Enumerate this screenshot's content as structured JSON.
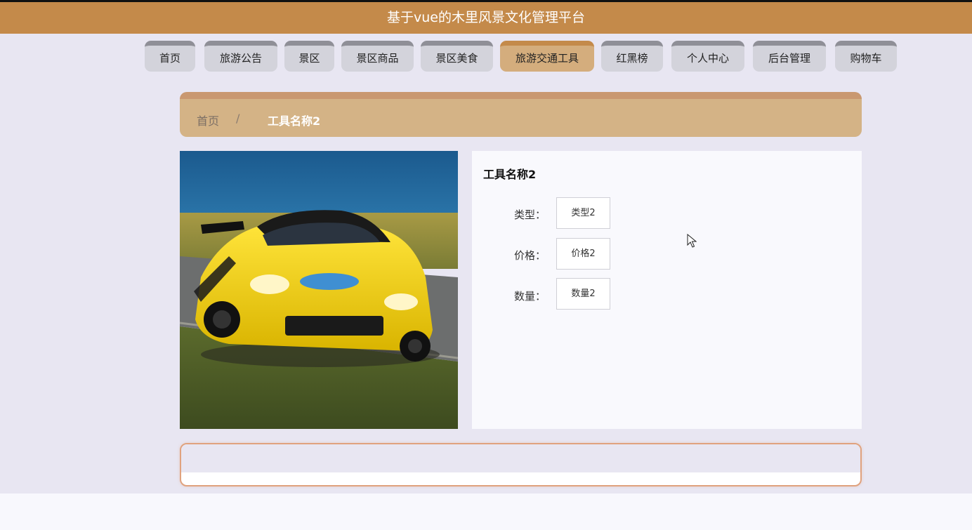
{
  "header": {
    "title": "基于vue的木里风景文化管理平台"
  },
  "nav": {
    "items": [
      {
        "label": "首页",
        "active": false
      },
      {
        "label": "旅游公告",
        "active": false
      },
      {
        "label": "景区",
        "active": false
      },
      {
        "label": "景区商品",
        "active": false
      },
      {
        "label": "景区美食",
        "active": false
      },
      {
        "label": "旅游交通工具",
        "active": true
      },
      {
        "label": "红黑榜",
        "active": false
      },
      {
        "label": "个人中心",
        "active": false
      },
      {
        "label": "后台管理",
        "active": false
      },
      {
        "label": "购物车",
        "active": false
      }
    ]
  },
  "breadcrumb": {
    "home": "首页",
    "separator": "/",
    "current": "工具名称2"
  },
  "detail": {
    "title": "工具名称2",
    "fields": [
      {
        "label": "类型：",
        "value": "类型2"
      },
      {
        "label": "价格：",
        "value": "价格2"
      },
      {
        "label": "数量：",
        "value": "数量2"
      }
    ]
  },
  "colors": {
    "header": "#c48a4a",
    "nav_active": "#d4ad7d",
    "breadcrumb": "#d4b386",
    "page_bg": "#e8e6f2",
    "comment_border": "#e0a27e"
  }
}
